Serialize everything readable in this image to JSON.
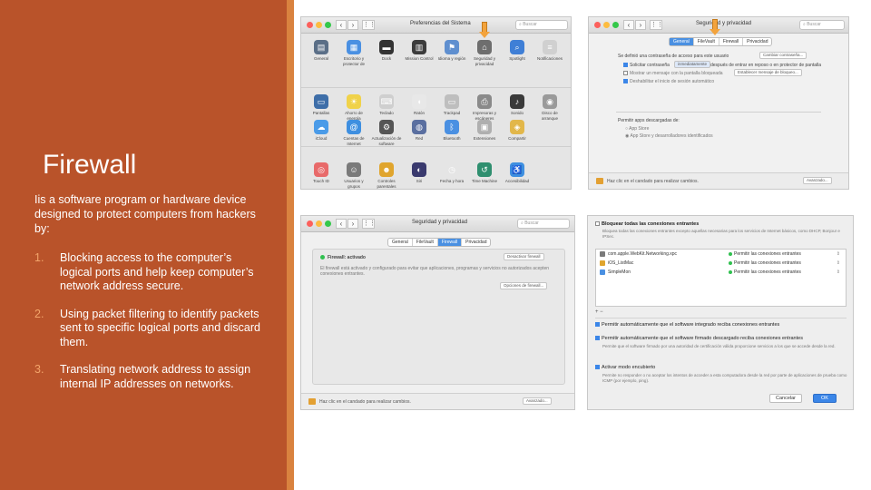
{
  "slide": {
    "title": "Firewall",
    "intro": "Iis a software program or hardware device designed to protect computers from hackers by:",
    "points": [
      {
        "num": "1.",
        "text": "Blocking access to the computer’s logical ports and help keep computer’s network address secure."
      },
      {
        "num": "2.",
        "text": "Using packet filtering to identify packets sent to specific logical ports and discard them."
      },
      {
        "num": "3.",
        "text": "Translating network address to assign internal IP addresses on networks."
      }
    ]
  },
  "colors": {
    "left_panel": "#B9532A",
    "left_stripe": "#D9823F",
    "accent_arrow": "#F3A33C",
    "mac_blue": "#3B86E8",
    "status_green": "#30C04F"
  },
  "win_sysprefs": {
    "title": "Preferencias del Sistema",
    "search_placeholder": "Buscar",
    "rows": [
      [
        {
          "label": "General",
          "icon": "general-icon",
          "color": "#5B6F87",
          "glyph": "▤"
        },
        {
          "label": "Escritorio y protector de pantalla",
          "icon": "desktop-icon",
          "color": "#4A90E2",
          "glyph": "▦"
        },
        {
          "label": "Dock",
          "icon": "dock-icon",
          "color": "#333333",
          "glyph": "▬"
        },
        {
          "label": "Mission Control",
          "icon": "mission-control-icon",
          "color": "#3C3C3C",
          "glyph": "▥"
        },
        {
          "label": "Idioma y región",
          "icon": "language-icon",
          "color": "#5F8FCF",
          "glyph": "⚑"
        },
        {
          "label": "Seguridad y privacidad",
          "icon": "security-icon",
          "color": "#6E6E6E",
          "glyph": "⌂"
        },
        {
          "label": "Spotlight",
          "icon": "spotlight-icon",
          "color": "#3F7FD6",
          "glyph": "⌕"
        },
        {
          "label": "Notificaciones",
          "icon": "notifications-icon",
          "color": "#D0D0D0",
          "glyph": "≡"
        }
      ],
      [
        {
          "label": "Pantallas",
          "icon": "displays-icon",
          "color": "#3E6EA8",
          "glyph": "▭"
        },
        {
          "label": "Ahorro de energía",
          "icon": "energy-icon",
          "color": "#F0D24A",
          "glyph": "☀"
        },
        {
          "label": "Teclado",
          "icon": "keyboard-icon",
          "color": "#CFCFCF",
          "glyph": "⌨"
        },
        {
          "label": "Ratón",
          "icon": "mouse-icon",
          "color": "#E8E8E8",
          "glyph": "◖"
        },
        {
          "label": "Trackpad",
          "icon": "trackpad-icon",
          "color": "#BEBEBE",
          "glyph": "▭"
        },
        {
          "label": "Impresoras y escáneres",
          "icon": "printer-icon",
          "color": "#8A8A8A",
          "glyph": "⎙"
        },
        {
          "label": "Sonido",
          "icon": "sound-icon",
          "color": "#3A3A3A",
          "glyph": "♪"
        },
        {
          "label": "Disco de arranque",
          "icon": "startup-disk-icon",
          "color": "#9A9A9A",
          "glyph": "◉"
        }
      ],
      [
        {
          "label": "iCloud",
          "icon": "icloud-icon",
          "color": "#4A9BE8",
          "glyph": "☁"
        },
        {
          "label": "Cuentas de Internet",
          "icon": "internet-accounts-icon",
          "color": "#3E8FE0",
          "glyph": "@"
        },
        {
          "label": "Actualización de software",
          "icon": "software-update-icon",
          "color": "#555555",
          "glyph": "⚙"
        },
        {
          "label": "Red",
          "icon": "network-icon",
          "color": "#5A6FA0",
          "glyph": "◍"
        },
        {
          "label": "Bluetooth",
          "icon": "bluetooth-icon",
          "color": "#4A90E2",
          "glyph": "ᛒ"
        },
        {
          "label": "Extensiones",
          "icon": "extensions-icon",
          "color": "#AFAFAF",
          "glyph": "▣"
        },
        {
          "label": "Compartir",
          "icon": "sharing-icon",
          "color": "#E2B74A",
          "glyph": "◈"
        }
      ],
      [
        {
          "label": "Touch ID",
          "icon": "touch-id-icon",
          "color": "#E86A6A",
          "glyph": "◎"
        },
        {
          "label": "Usuarios y grupos",
          "icon": "users-icon",
          "color": "#7A7A7A",
          "glyph": "☺"
        },
        {
          "label": "Controles parentales",
          "icon": "parental-controls-icon",
          "color": "#E0A52E",
          "glyph": "☻"
        },
        {
          "label": "Siri",
          "icon": "siri-icon",
          "color": "#3A3A6E",
          "glyph": "◐"
        },
        {
          "label": "Fecha y hora",
          "icon": "date-time-icon",
          "color": "#E5E5E5",
          "glyph": "◷"
        },
        {
          "label": "Time Machine",
          "icon": "time-machine-icon",
          "color": "#2F8F6F",
          "glyph": "↺"
        },
        {
          "label": "Accesibilidad",
          "icon": "accessibility-icon",
          "color": "#3E8FE0",
          "glyph": "♿"
        }
      ]
    ]
  },
  "win_security_general": {
    "title": "Seguridad y privacidad",
    "search_placeholder": "Buscar",
    "tabs": [
      "General",
      "FileVault",
      "Firewall",
      "Privacidad"
    ],
    "active_tab": 0,
    "line1": "Se definió una contraseña de acceso para este usuario",
    "change_password": "Cambiar contraseña...",
    "require_password": "Solicitar contraseña",
    "require_value": "inmediatamente",
    "require_suffix": "después de entrar en reposo o en protector de pantalla",
    "show_message": "Mostrar un mensaje con la pantalla bloqueada",
    "set_message": "Establecer mensaje de bloqueo...",
    "disable_login": "Deshabilitar el inicio de sesión automático",
    "allow_apps": "Permitir apps descargadas de:",
    "app_store": "App Store",
    "app_store_dev": "App Store y desarrolladores identificados",
    "lock_text": "Haz clic en el candado para realizar cambios.",
    "advanced": "Avanzado..."
  },
  "win_security_firewall": {
    "title": "Seguridad y privacidad",
    "search_placeholder": "Buscar",
    "tabs": [
      "General",
      "FileVault",
      "Firewall",
      "Privacidad"
    ],
    "active_tab": 2,
    "status": "Firewall: activado",
    "turn_off": "Desactivar firewall",
    "description": "El firewall está activado y configurado para evitar que aplicaciones, programas y servicios no autorizados acepten conexiones entrantes.",
    "options": "Opciones de firewall...",
    "lock_text": "Haz clic en el candado para realizar cambios.",
    "advanced": "Avanzado..."
  },
  "win_firewall_options": {
    "block_all": "Bloquear todas las conexiones entrantes",
    "block_all_desc": "Bloquea todas las conexiones entrantes excepto aquellas necesarias para los servicios de Internet básicos, como DHCP, Bonjour e IPSec.",
    "apps": [
      {
        "name": "com.apple.WebKit.Networking.xpc",
        "icon": "webkit-app-icon",
        "color": "#7A7A7A",
        "permission": "Permitir las conexiones entrantes"
      },
      {
        "name": "iOS_ListMac",
        "icon": "ios-list-app-icon",
        "color": "#E0A52E",
        "permission": "Permitir las conexiones entrantes"
      },
      {
        "name": "SimpleMon",
        "icon": "simplemon-app-icon",
        "color": "#4A90E2",
        "permission": "Permitir las conexiones entrantes"
      }
    ],
    "stepper": "⇕",
    "add_remove": "+ −",
    "auto_builtin": "Permitir automáticamente que el software integrado reciba conexiones entrantes",
    "auto_signed": "Permitir automáticamente que el software firmado descargado reciba conexiones entrantes",
    "auto_signed_desc": "Permite que el software firmado por una autoridad de certificación válida proporcione servicios a los que se accede desde la red.",
    "stealth": "Activar modo encubierto",
    "stealth_desc": "Permite no responder o no aceptar los intentos de acceder a esta computadora desde la red por parte de aplicaciones de prueba como ICMP (por ejemplo, ping).",
    "cancel": "Cancelar",
    "ok": "OK"
  }
}
